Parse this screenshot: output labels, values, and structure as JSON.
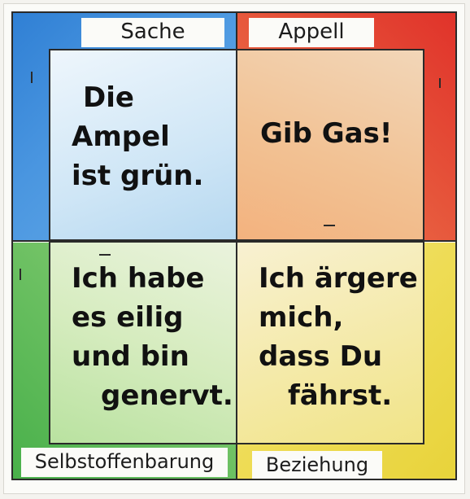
{
  "labels": {
    "sache": "Sache",
    "appell": "Appell",
    "selbstoffenbarung": "Selbstoffenbarung",
    "beziehung": "Beziehung"
  },
  "messages": {
    "sache": [
      "Die",
      "Ampel",
      "ist grün."
    ],
    "appell": [
      "Gib Gas!"
    ],
    "selbstoffenbarung": [
      "Ich habe",
      "es eilig",
      "und bin",
      "genervt."
    ],
    "beziehung": [
      "Ich ärgere",
      "mich,",
      "dass Du",
      "fährst."
    ]
  },
  "colors": {
    "sache": "#2f7fd4",
    "appell": "#e0322a",
    "selbstoffenbarung": "#48b04a",
    "beziehung": "#e8d33a"
  }
}
